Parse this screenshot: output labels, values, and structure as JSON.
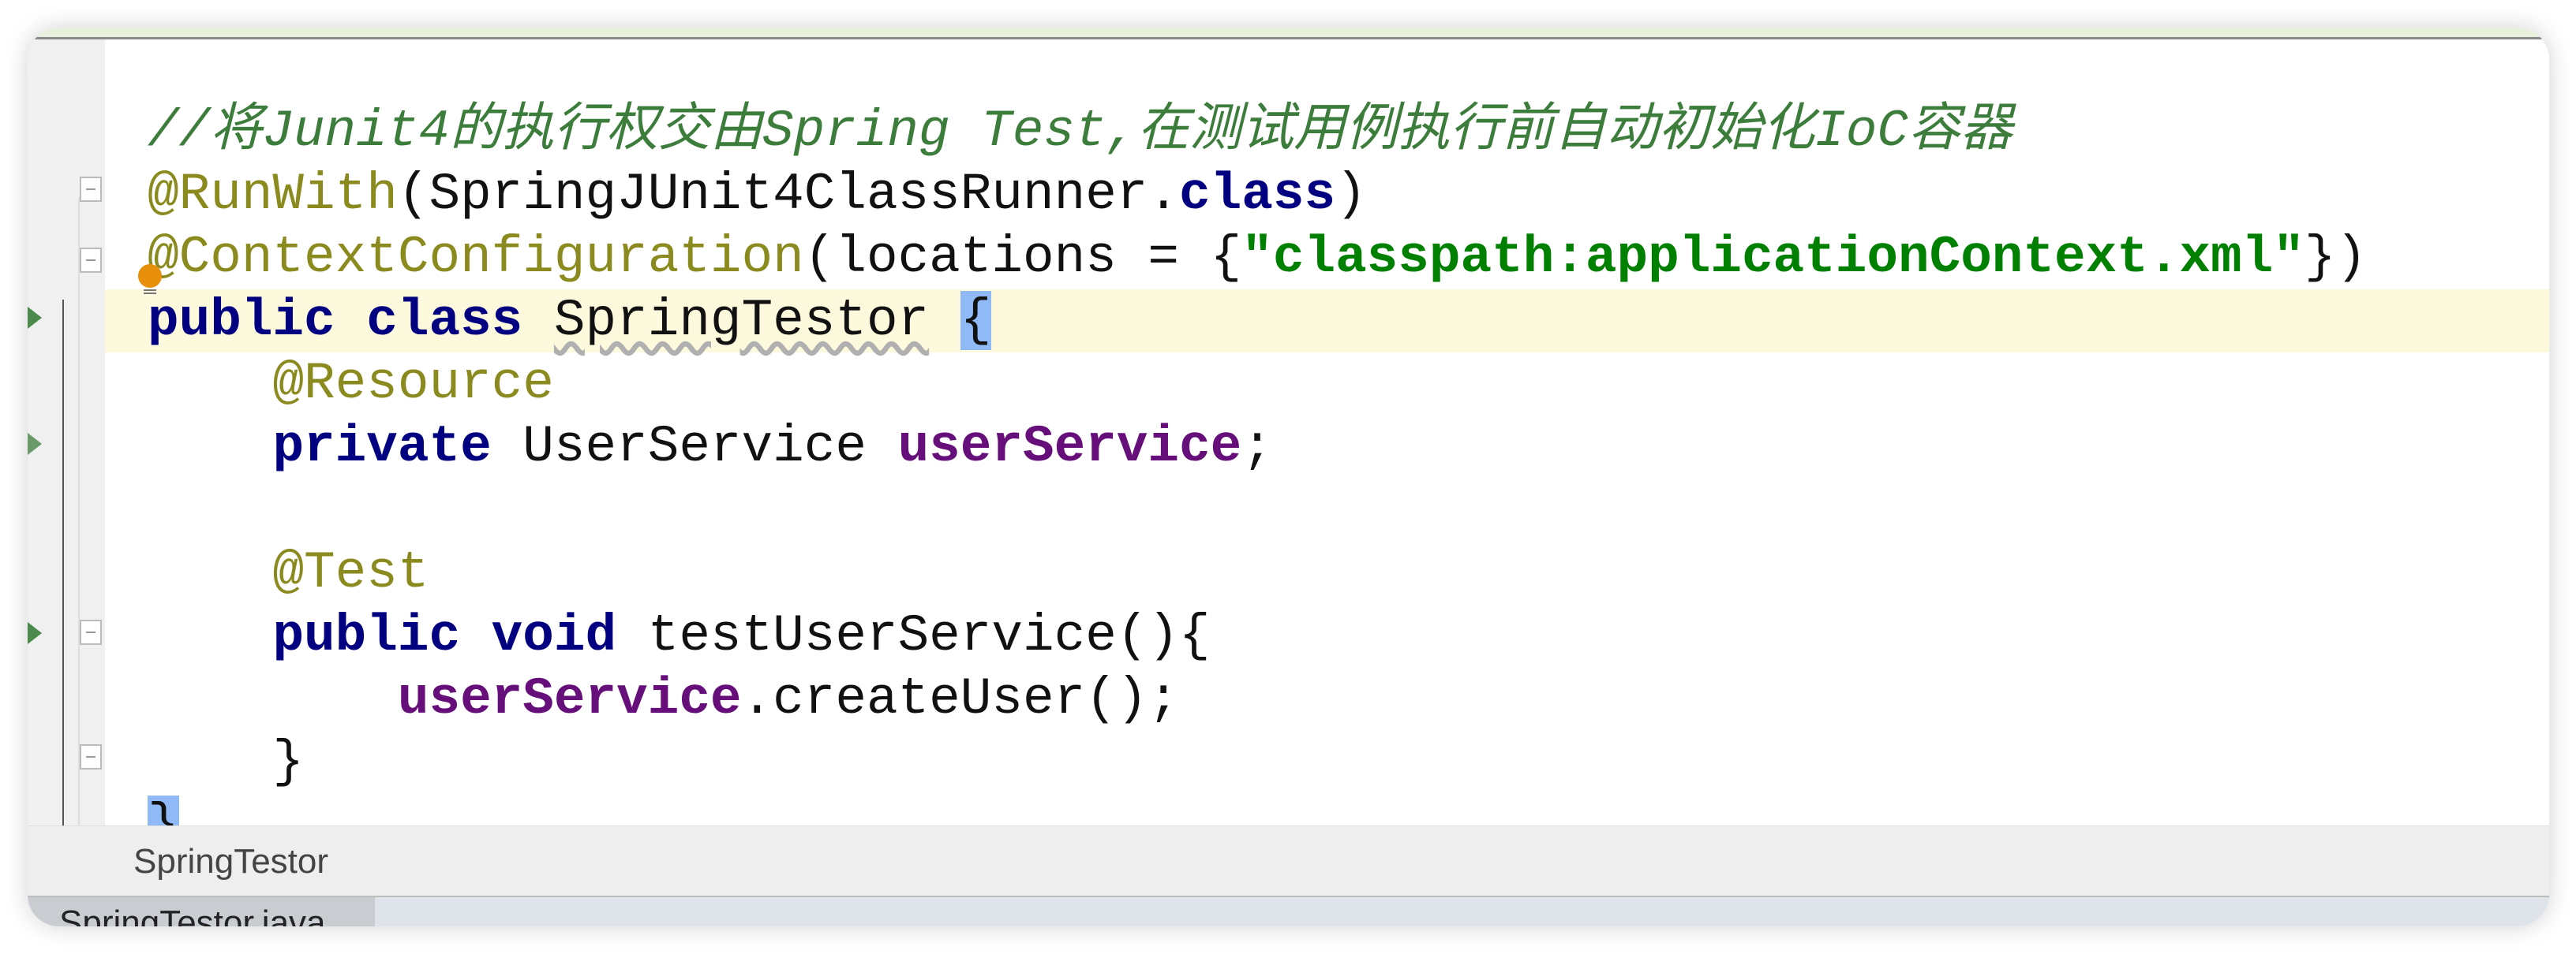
{
  "editor": {
    "lines": [
      {
        "tokens": [
          {
            "text": "//将Junit4的执行权交由Spring Test,在测试用例执行前自动初始化IoC容器",
            "type": "comment"
          }
        ]
      },
      {
        "tokens": [
          {
            "text": "@RunWith",
            "type": "annotation"
          },
          {
            "text": "(SpringJUnit4ClassRunner.",
            "type": "plain"
          },
          {
            "text": "class",
            "type": "keyword"
          },
          {
            "text": ")",
            "type": "plain"
          }
        ]
      },
      {
        "tokens": [
          {
            "text": "@ContextConfiguration",
            "type": "annotation"
          },
          {
            "text": "(locations = {",
            "type": "plain"
          },
          {
            "text": "\"classpath:applicationContext.xml\"",
            "type": "string"
          },
          {
            "text": "})",
            "type": "plain"
          }
        ]
      },
      {
        "current": true,
        "tokens": [
          {
            "text": "public class ",
            "type": "keyword"
          },
          {
            "text": "SpringTestor",
            "type": "plain warn"
          },
          {
            "text": " ",
            "type": "plain"
          },
          {
            "text": "{",
            "type": "plain brace-hl"
          }
        ]
      },
      {
        "tokens": [
          {
            "text": "    ",
            "type": "plain"
          },
          {
            "text": "@Resource",
            "type": "annotation"
          }
        ]
      },
      {
        "tokens": [
          {
            "text": "    ",
            "type": "plain"
          },
          {
            "text": "private ",
            "type": "keyword"
          },
          {
            "text": "UserService ",
            "type": "plain"
          },
          {
            "text": "userService",
            "type": "field"
          },
          {
            "text": ";",
            "type": "plain"
          }
        ]
      },
      {
        "tokens": []
      },
      {
        "tokens": [
          {
            "text": "    ",
            "type": "plain"
          },
          {
            "text": "@Test",
            "type": "annotation"
          }
        ]
      },
      {
        "tokens": [
          {
            "text": "    ",
            "type": "plain"
          },
          {
            "text": "public void ",
            "type": "keyword"
          },
          {
            "text": "testUserService(){",
            "type": "plain"
          }
        ]
      },
      {
        "tokens": [
          {
            "text": "        ",
            "type": "plain"
          },
          {
            "text": "userService",
            "type": "field"
          },
          {
            "text": ".createUser();",
            "type": "plain"
          }
        ]
      },
      {
        "tokens": [
          {
            "text": "    }",
            "type": "plain"
          }
        ]
      },
      {
        "tokens": [
          {
            "text": "}",
            "type": "plain brace-hl"
          }
        ]
      }
    ]
  },
  "breadcrumb": {
    "item": "SpringTestor"
  },
  "tabs": [
    {
      "label": "SpringTestor.java"
    }
  ],
  "colors": {
    "comment": "#3c7d3c",
    "annotation": "#8a8a1e",
    "keyword": "#000080",
    "field": "#660e7a",
    "string": "#008000",
    "current_line": "#fdf9dd",
    "brace_highlight": "#8fbaf7"
  },
  "icons": [
    "fold-icon",
    "run-icon",
    "lightbulb-icon"
  ]
}
